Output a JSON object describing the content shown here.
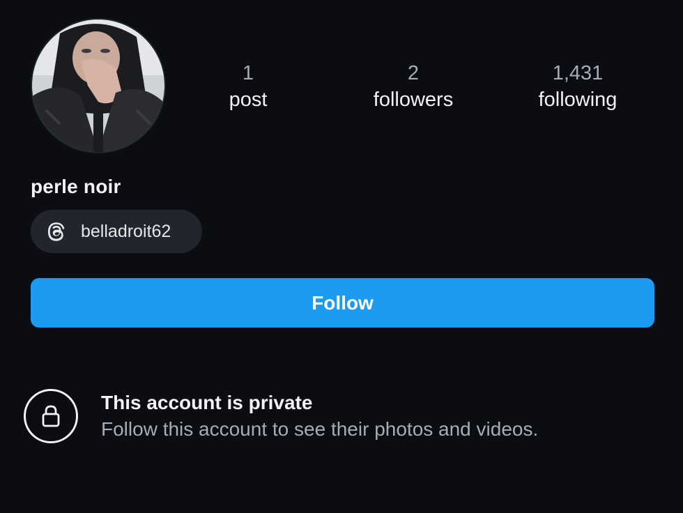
{
  "profile": {
    "display_name": "perle noir",
    "avatar_icon": "profile-photo"
  },
  "stats": {
    "posts_count": "1",
    "posts_label": "post",
    "followers_count": "2",
    "followers_label": "followers",
    "following_count": "1,431",
    "following_label": "following"
  },
  "threads": {
    "icon": "threads-icon",
    "handle": "belladroit62"
  },
  "actions": {
    "follow_label": "Follow"
  },
  "private_notice": {
    "icon": "lock-icon",
    "title": "This account is private",
    "description": "Follow this account to see their photos and videos."
  },
  "colors": {
    "background": "#0b0d12",
    "primary_button": "#1c9bf0",
    "chip_background": "#22252b",
    "secondary_text": "#a8acb3"
  }
}
